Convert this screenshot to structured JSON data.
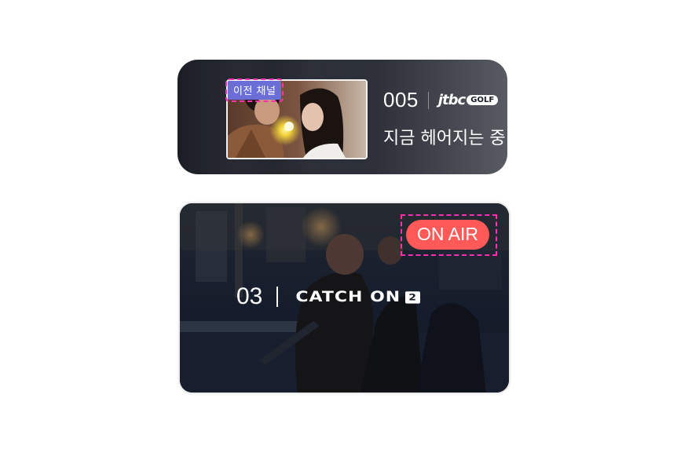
{
  "previous_channel": {
    "badge": "이전 채널",
    "number": "005",
    "logo_text": "jtbc",
    "logo_sub": "GOLF",
    "program_title": "지금 헤어지는 중",
    "colors": {
      "badge_bg": "#6a6ed6",
      "card_bg": "#1b1e25"
    }
  },
  "current_channel": {
    "badge": "ON AIR",
    "number": "03",
    "logo_text": "CATCH ON",
    "logo_num": "2",
    "colors": {
      "badge_bg": "#ff5a57",
      "card_bg": "#1a2130"
    }
  },
  "highlight_color": "#ff2fb4"
}
